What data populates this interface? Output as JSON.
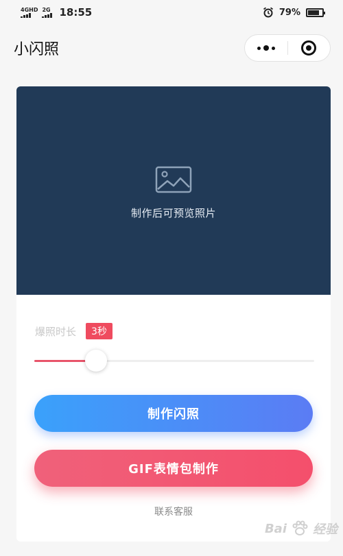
{
  "status_bar": {
    "network_1": "4GHD",
    "network_2": "2G",
    "time": "18:55",
    "battery": "79%",
    "battery_level": 0.79,
    "icons": [
      "signal-icon",
      "alarm-icon",
      "battery-icon"
    ]
  },
  "nav": {
    "title": "小闪照",
    "icons": [
      "more-icon",
      "close-target-icon"
    ]
  },
  "preview": {
    "icon": "image-placeholder-icon",
    "text": "制作后可预览照片",
    "background": "#213a57"
  },
  "settings": {
    "duration_label": "爆照时长",
    "duration_value": "3秒",
    "slider_level": 0.22
  },
  "actions": {
    "make_label": "制作闪照",
    "gif_label": "GIF表情包制作",
    "contact_label": "联系客服"
  },
  "colors": {
    "accent_red": "#ef4b5f",
    "accent_blue": "#3aa1fb"
  },
  "watermark": {
    "text": "Bai",
    "brand": "经验"
  }
}
